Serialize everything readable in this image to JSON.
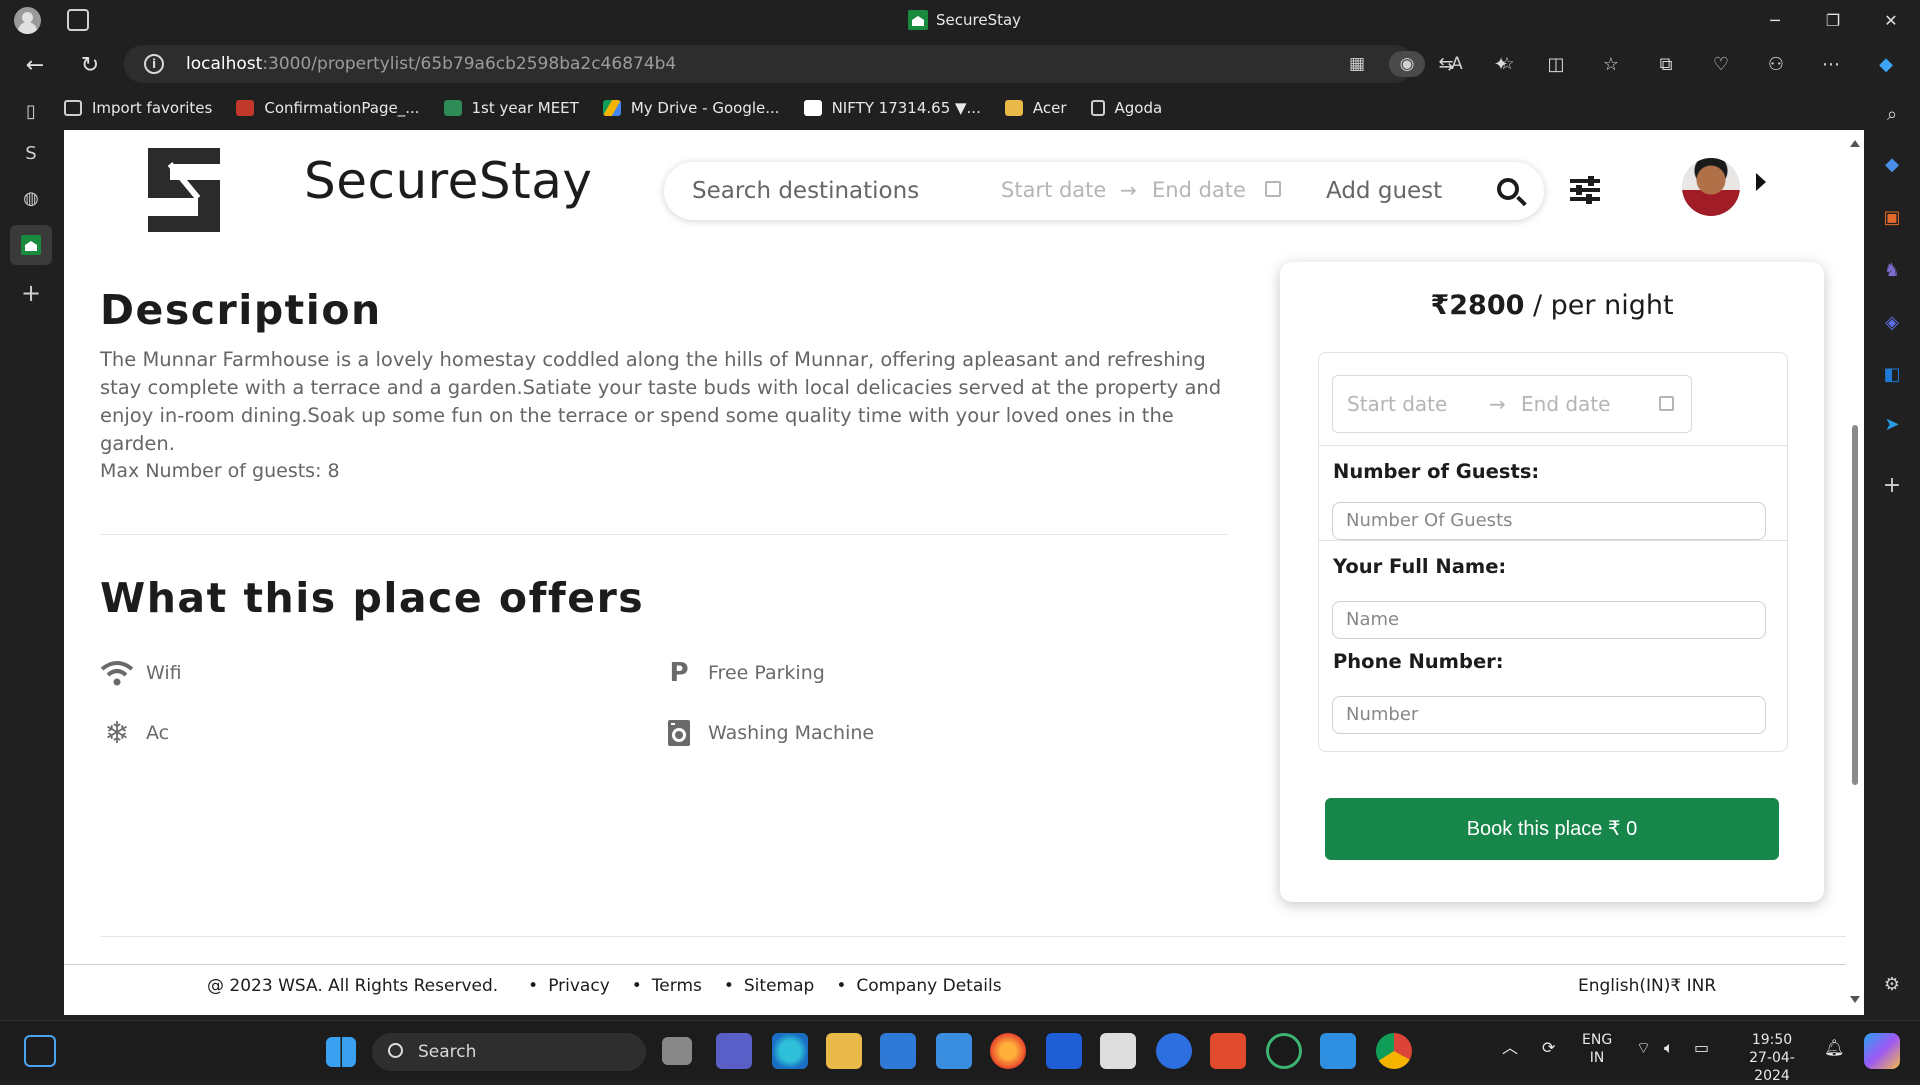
{
  "browser": {
    "window_title": "SecureStay",
    "url_host": "localhost",
    "url_rest": ":3000/propertylist/65b79a6cb2598ba2c46874b4"
  },
  "favorites": [
    {
      "label": "Import favorites",
      "icon": "import-icon",
      "color": "#cfcfcf"
    },
    {
      "label": "ConfirmationPage_...",
      "icon": "pdf-icon",
      "color": "#c0392b"
    },
    {
      "label": "1st year MEET",
      "icon": "meet-icon",
      "color": "#2e8b57"
    },
    {
      "label": "My Drive - Google...",
      "icon": "drive-icon",
      "color": "#f4b400"
    },
    {
      "label": "NIFTY 17314.65 ▼...",
      "icon": "tradingview-icon",
      "color": "#ffffff"
    },
    {
      "label": "Acer",
      "icon": "folder-icon",
      "color": "#e9b949"
    },
    {
      "label": "Agoda",
      "icon": "page-icon",
      "color": "#cfcfcf"
    }
  ],
  "site": {
    "brand": "SecureStay",
    "search": {
      "destination_placeholder": "Search destinations",
      "start_placeholder": "Start date",
      "end_placeholder": "End date",
      "guest_placeholder": "Add guest"
    }
  },
  "description": {
    "heading": "Description",
    "text": "The Munnar Farmhouse is a lovely homestay coddled along the hills of Munnar, offering apleasant and refreshing stay complete with a terrace and a garden.Satiate your taste buds with local delicacies served at the property and enjoy in-room dining.Soak up some fun on the terrace or spend some quality time with your loved ones in the garden.",
    "max_guests": "Max Number of guests: 8"
  },
  "offers": {
    "heading": "What this place offers",
    "items": [
      {
        "label": "Wifi",
        "icon": "wifi-icon"
      },
      {
        "label": "Free Parking",
        "icon": "parking-icon"
      },
      {
        "label": "Ac",
        "icon": "snowflake-icon"
      },
      {
        "label": "Washing Machine",
        "icon": "washing-machine-icon"
      }
    ]
  },
  "booking": {
    "price": "₹2800",
    "per_night": " / per night",
    "start_placeholder": "Start date",
    "end_placeholder": "End date",
    "guests_label": "Number of Guests:",
    "guests_placeholder": "Number Of Guests",
    "name_label": "Your Full Name:",
    "name_placeholder": "Name",
    "phone_label": "Phone Number:",
    "phone_placeholder": "Number",
    "book_button": "Book this place ₹ 0",
    "accent_color": "#16864a"
  },
  "footer": {
    "copyright": "@ 2023 WSA. All Rights Reserved.",
    "links": [
      "Privacy",
      "Terms",
      "Sitemap",
      "Company Details"
    ],
    "locale": "English(IN)₹ INR"
  },
  "taskbar": {
    "search_label": "Search",
    "lang_top": "ENG",
    "lang_bottom": "IN",
    "time": "19:50",
    "date": "27-04-2024"
  }
}
